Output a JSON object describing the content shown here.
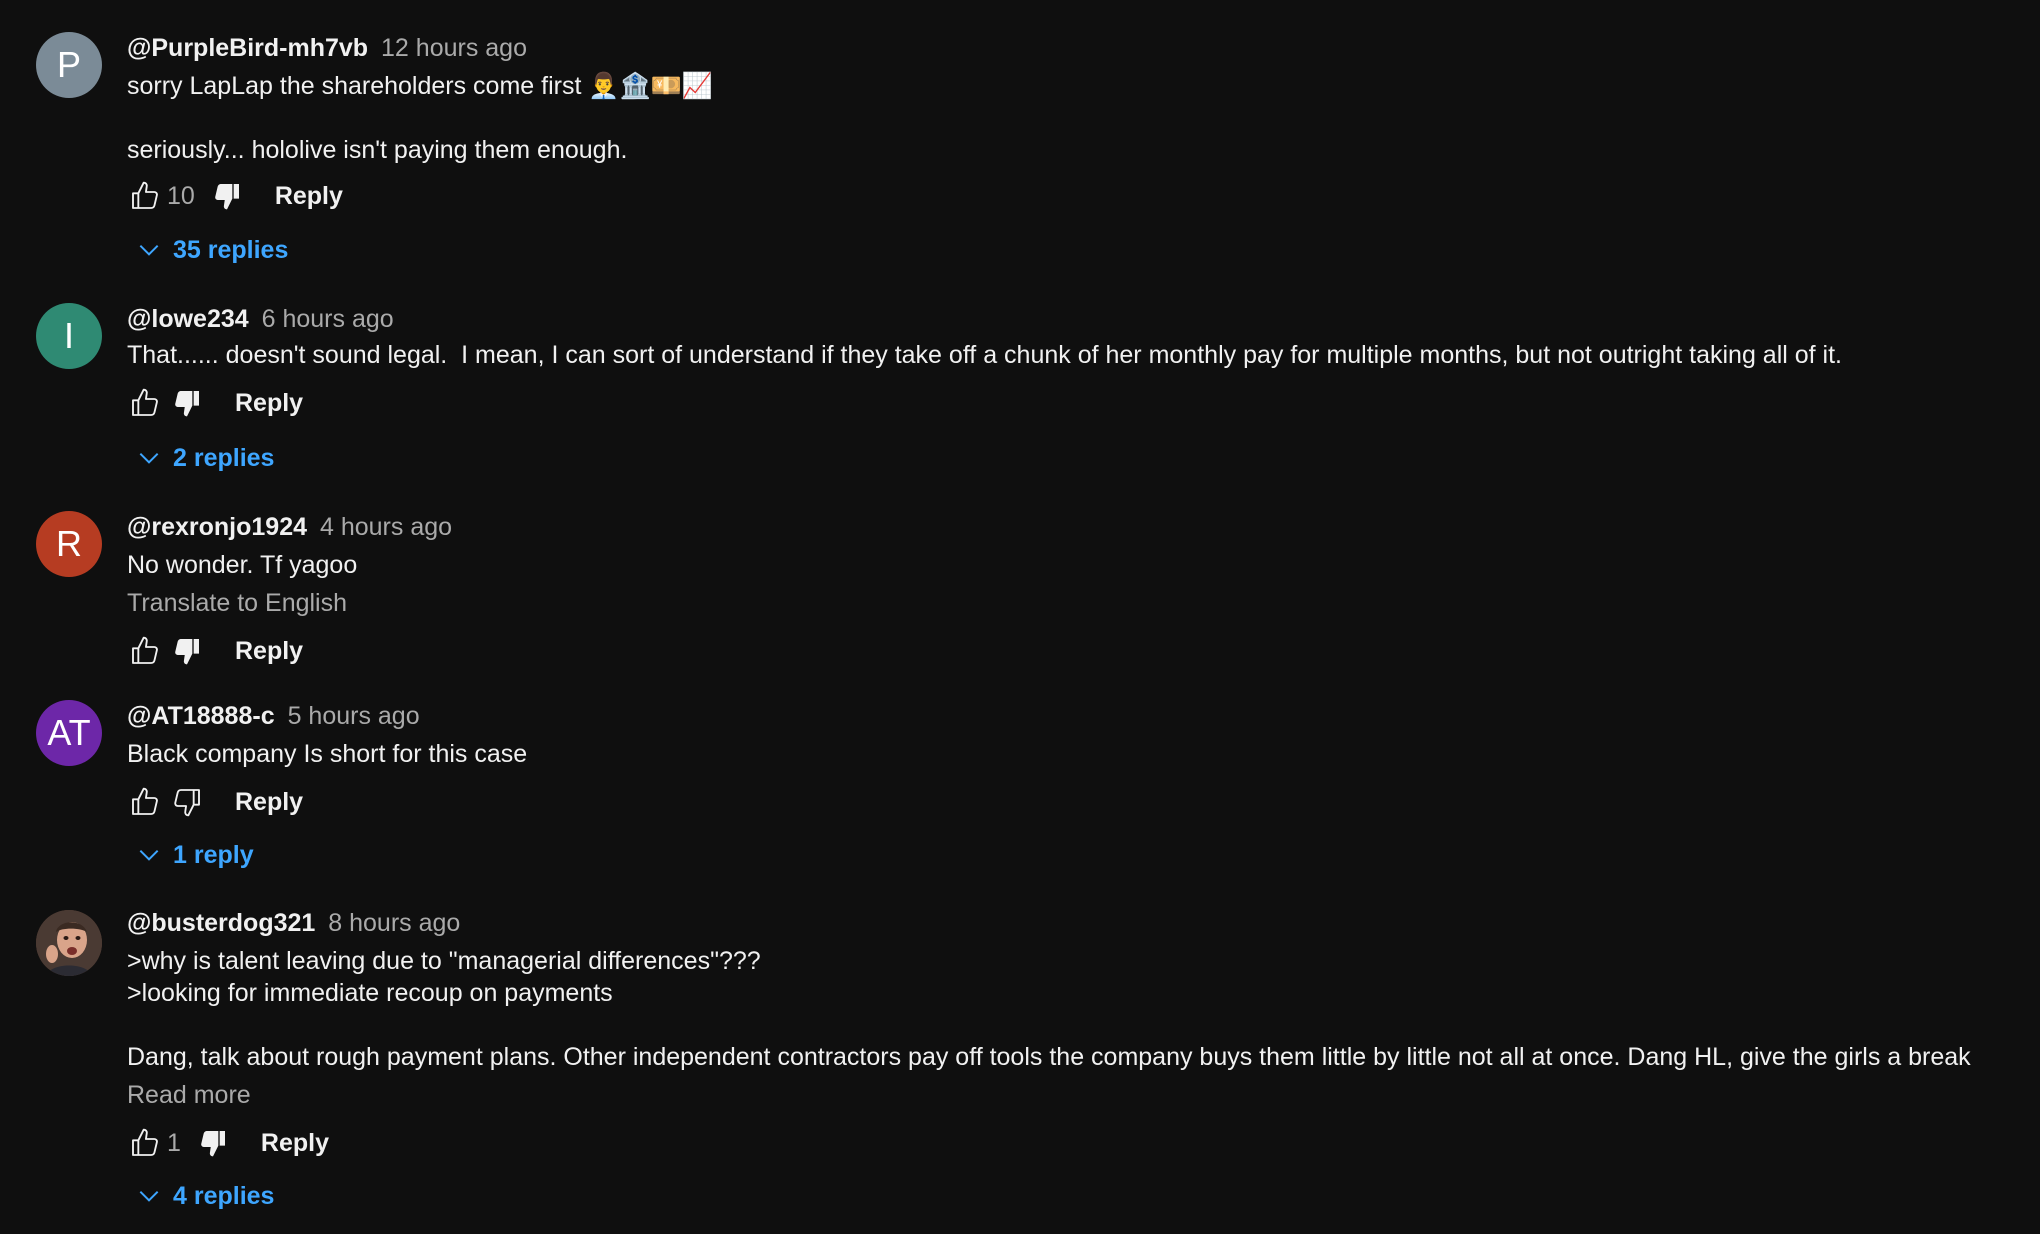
{
  "comments": [
    {
      "avatar_letter": "P",
      "avatar_color": "#7b8b97",
      "author": "@PurpleBird-mh7vb",
      "time": "12 hours ago",
      "line1": "sorry LapLap the shareholders come first 👨‍💼🏦💴📈",
      "line2": "seriously... hololive isn't paying them enough.",
      "likes": "10",
      "reply_label": "Reply",
      "replies_label": "35 replies"
    },
    {
      "avatar_letter": "I",
      "avatar_color": "#2f8a73",
      "author": "@lowe234",
      "time": "6 hours ago",
      "line1": "That...... doesn't sound legal.  I mean, I can sort of understand if they take off a chunk of her monthly pay for multiple months, but not outright taking all of it.",
      "reply_label": "Reply",
      "replies_label": "2 replies"
    },
    {
      "avatar_letter": "R",
      "avatar_color": "#b63c22",
      "author": "@rexronjo1924",
      "time": "4 hours ago",
      "line1": "No wonder. Tf yagoo",
      "translate_label": "Translate to English",
      "reply_label": "Reply"
    },
    {
      "avatar_letter": "AT",
      "avatar_color": "#6d27a8",
      "author": "@AT18888-c",
      "time": "5 hours ago",
      "line1": "Black company Is short for this case",
      "reply_label": "Reply",
      "replies_label": "1 reply"
    },
    {
      "avatar_color": "#5a3a2e",
      "author": "@busterdog321",
      "time": "8 hours ago",
      "line1": ">why is talent leaving due to \"managerial differences\"???",
      "line2": ">looking for immediate recoup on payments",
      "line3": "Dang, talk about rough payment plans. Other independent contractors pay off tools the company buys them little by little not all at once. Dang HL, give the girls a break",
      "read_more_label": "Read more",
      "likes": "1",
      "reply_label": "Reply",
      "replies_label": "4 replies"
    }
  ],
  "colors": {
    "background": "#0f0f0f",
    "text": "#f1f1f1",
    "muted": "#aaaaaa",
    "link": "#3ea6ff"
  }
}
